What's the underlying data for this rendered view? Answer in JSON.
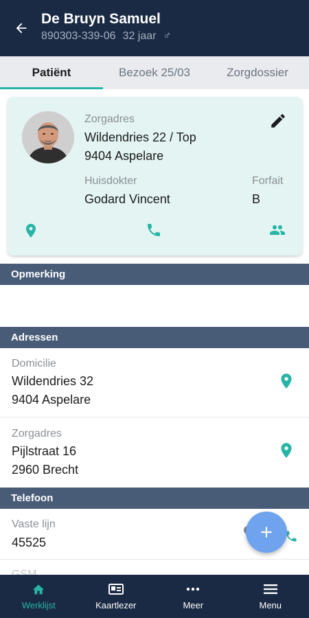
{
  "header": {
    "name": "De Bruyn Samuel",
    "id": "890303-339-06",
    "age": "32 jaar",
    "gender_symbol": "♂",
    "back_icon": "arrow-left-icon"
  },
  "tabs": [
    {
      "label": "Patiënt",
      "active": true
    },
    {
      "label": "Bezoek 25/03",
      "active": false
    },
    {
      "label": "Zorgdossier",
      "active": false
    }
  ],
  "card": {
    "zorgadres_label": "Zorgadres",
    "zorgadres_line1": "Wildendries 22 / Top",
    "zorgadres_line2": "9404 Aspelare",
    "huisdokter_label": "Huisdokter",
    "huisdokter_value": "Godard Vincent",
    "forfait_label": "Forfait",
    "forfait_value": "B",
    "actions": [
      "location-pin-icon",
      "phone-icon",
      "people-icon"
    ]
  },
  "sections": {
    "opmerking": "Opmerking",
    "adressen": "Adressen",
    "telefoon": "Telefoon"
  },
  "addresses": [
    {
      "label": "Domicilie",
      "line1": "Wildendries 32",
      "line2": "9404 Aspelare"
    },
    {
      "label": "Zorgadres",
      "line1": "Pijlstraat 16",
      "line2": "2960 Brecht"
    }
  ],
  "phones": [
    {
      "label": "Vaste lijn",
      "value": "45525"
    },
    {
      "label": "GSM",
      "value": ""
    }
  ],
  "fab_symbol": "+",
  "nav": [
    {
      "label": "Werklijst",
      "icon": "home-icon",
      "active": true
    },
    {
      "label": "Kaartlezer",
      "icon": "card-reader-icon",
      "active": false
    },
    {
      "label": "Meer",
      "icon": "more-dots-icon",
      "active": false
    },
    {
      "label": "Menu",
      "icon": "hamburger-menu-icon",
      "active": false
    }
  ],
  "colors": {
    "header_bg": "#1b2a44",
    "accent": "#26b5a6",
    "section_bg": "#485c78",
    "card_bg": "#e3f4f2",
    "fab_bg": "#6fa3ee"
  }
}
